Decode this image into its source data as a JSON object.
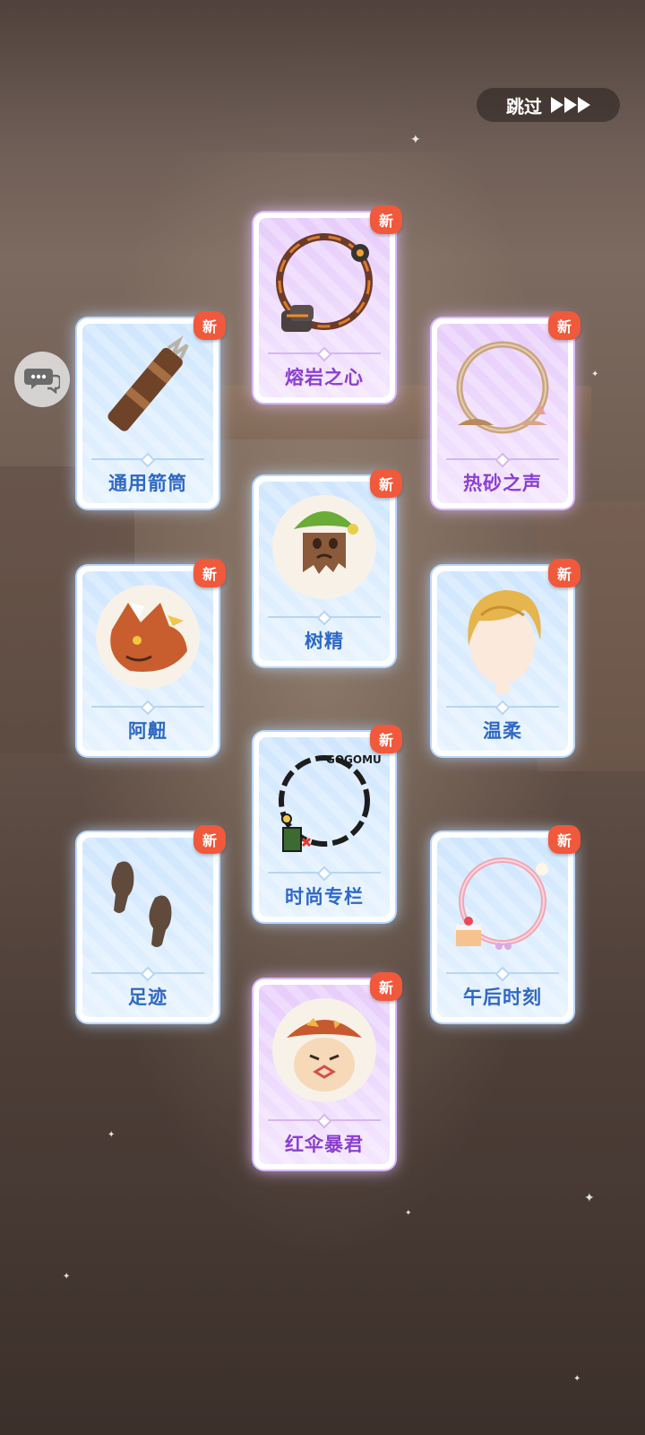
{
  "skip_button": {
    "label": "跳过"
  },
  "new_badge": "新",
  "cards": [
    {
      "name": "熔岩之心",
      "rarity": "purple",
      "icon": "lava-frame-icon"
    },
    {
      "name": "通用箭筒",
      "rarity": "blue",
      "icon": "quiver-icon"
    },
    {
      "name": "热砂之声",
      "rarity": "purple",
      "icon": "sand-frame-icon"
    },
    {
      "name": "树精",
      "rarity": "blue",
      "icon": "treant-icon"
    },
    {
      "name": "阿䶊",
      "rarity": "blue",
      "icon": "creature-icon"
    },
    {
      "name": "温柔",
      "rarity": "blue",
      "icon": "hair-icon"
    },
    {
      "name": "时尚专栏",
      "rarity": "blue",
      "icon": "gogo-muffin-frame-icon",
      "art_text": "GOGOMUFFIN"
    },
    {
      "name": "足迹",
      "rarity": "blue",
      "icon": "footprints-icon"
    },
    {
      "name": "午后时刻",
      "rarity": "blue",
      "icon": "cake-frame-icon"
    },
    {
      "name": "红伞暴君",
      "rarity": "purple",
      "icon": "mushroom-icon"
    }
  ]
}
